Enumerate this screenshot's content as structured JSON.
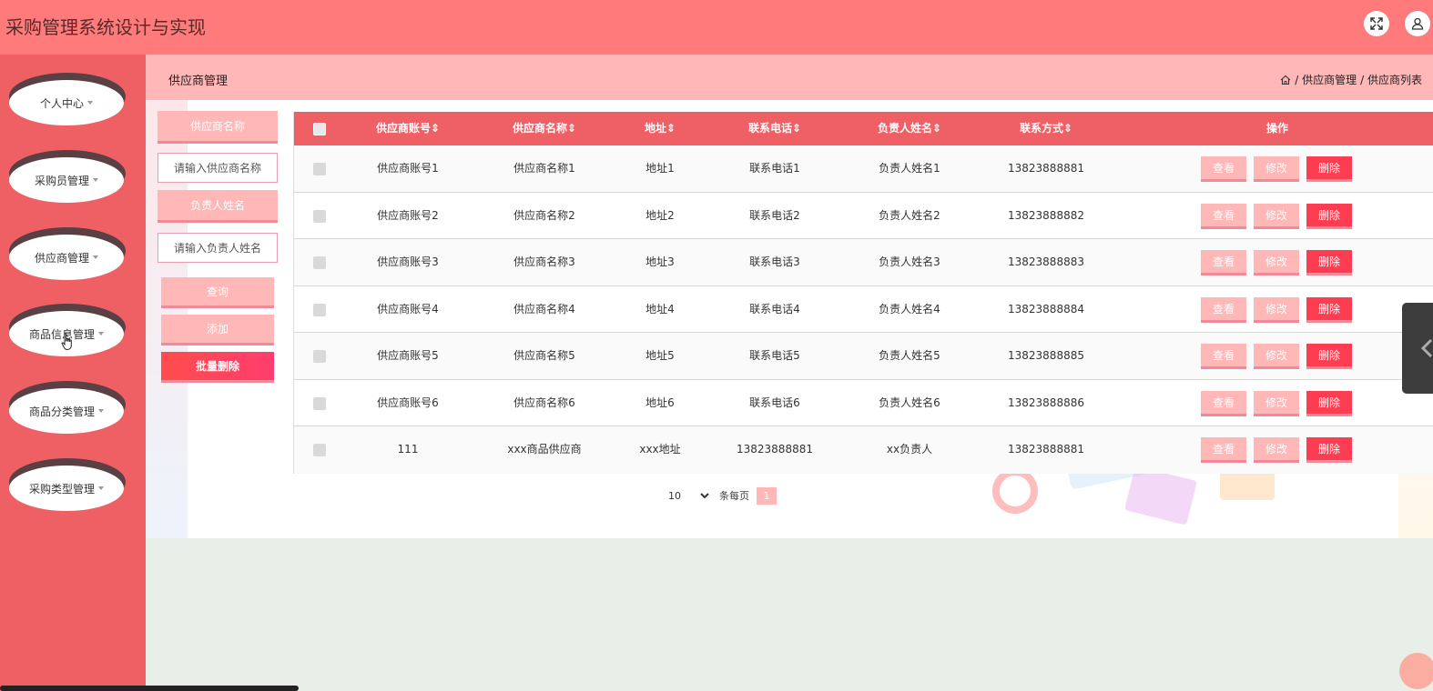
{
  "app": {
    "title": "采购管理系统设计与实现"
  },
  "sidebar": {
    "items": [
      {
        "label": "个人中心"
      },
      {
        "label": "采购员管理"
      },
      {
        "label": "供应商管理"
      },
      {
        "label": "商品信息管理"
      },
      {
        "label": "商品分类管理"
      },
      {
        "label": "采购类型管理"
      }
    ]
  },
  "header": {
    "page_title": "供应商管理",
    "breadcrumb": [
      "/ 供应商管理",
      "/ 供应商列表"
    ]
  },
  "search": {
    "name_label": "供应商名称",
    "name_placeholder": "请输入供应商名称",
    "person_label": "负责人姓名",
    "person_placeholder": "请输入负责人姓名",
    "query_button": "查询",
    "add_button": "添加",
    "batch_delete_button": "批量删除"
  },
  "table": {
    "columns": [
      "供应商账号",
      "供应商名称",
      "地址",
      "联系电话",
      "负责人姓名",
      "联系方式",
      "操作"
    ],
    "sort_indicator": "⇕",
    "actions": {
      "view": "查看",
      "edit": "修改",
      "delete": "删除"
    },
    "rows": [
      [
        "供应商账号1",
        "供应商名称1",
        "地址1",
        "联系电话1",
        "负责人姓名1",
        "13823888881"
      ],
      [
        "供应商账号2",
        "供应商名称2",
        "地址2",
        "联系电话2",
        "负责人姓名2",
        "13823888882"
      ],
      [
        "供应商账号3",
        "供应商名称3",
        "地址3",
        "联系电话3",
        "负责人姓名3",
        "13823888883"
      ],
      [
        "供应商账号4",
        "供应商名称4",
        "地址4",
        "联系电话4",
        "负责人姓名4",
        "13823888884"
      ],
      [
        "供应商账号5",
        "供应商名称5",
        "地址5",
        "联系电话5",
        "负责人姓名5",
        "13823888885"
      ],
      [
        "供应商账号6",
        "供应商名称6",
        "地址6",
        "联系电话6",
        "负责人姓名6",
        "13823888886"
      ],
      [
        "111",
        "xxx商品供应商",
        "xxx地址",
        "13823888881",
        "xx负责人",
        "13823888881"
      ]
    ]
  },
  "pagination": {
    "page_size": "10",
    "per_page_label": "条每页",
    "current_page": "1"
  },
  "colors": {
    "topbar": "#ff7b7b",
    "sidebar": "#ee6064",
    "subheader": "#ffb7b7",
    "table_header": "#ef6066",
    "danger": "#ff3d52"
  },
  "icons": {
    "fullscreen": "expand-icon",
    "user": "user-icon",
    "home": "home-icon",
    "collapse": "chevron-left-icon"
  }
}
